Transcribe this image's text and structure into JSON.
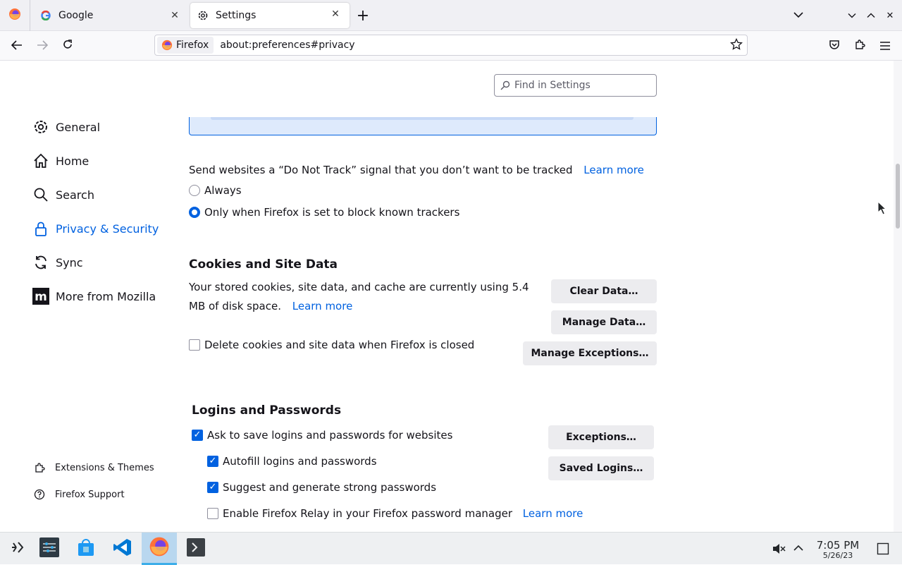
{
  "tabs": [
    {
      "label": "Google",
      "icon": "google-icon"
    },
    {
      "label": "Settings",
      "icon": "gear-icon"
    }
  ],
  "urlbar": {
    "identity_label": "Firefox",
    "url": "about:preferences#privacy"
  },
  "search": {
    "placeholder": "Find in Settings"
  },
  "sidebar": {
    "items": [
      {
        "label": "General",
        "icon": "gear-icon"
      },
      {
        "label": "Home",
        "icon": "home-icon"
      },
      {
        "label": "Search",
        "icon": "search-icon"
      },
      {
        "label": "Privacy & Security",
        "icon": "lock-icon",
        "selected": true
      },
      {
        "label": "Sync",
        "icon": "sync-icon"
      },
      {
        "label": "More from Mozilla",
        "icon": "mozilla-icon"
      }
    ],
    "footer": [
      {
        "label": "Extensions & Themes",
        "icon": "puzzle-icon"
      },
      {
        "label": "Firefox Support",
        "icon": "help-icon"
      }
    ]
  },
  "dnt": {
    "text": "Send websites a “Do Not Track” signal that you don’t want to be tracked",
    "learn_more": "Learn more",
    "options": [
      {
        "label": "Always",
        "selected": false
      },
      {
        "label": "Only when Firefox is set to block known trackers",
        "selected": true
      }
    ]
  },
  "cookies": {
    "heading": "Cookies and Site Data",
    "desc_line1": "Your stored cookies, site data, and cache are currently using 5.4",
    "desc_line2": "MB of disk space.",
    "learn_more": "Learn more",
    "delete_checkbox": {
      "label": "Delete cookies and site data when Firefox is closed",
      "checked": false
    },
    "buttons": {
      "clear": "Clear Data…",
      "manage": "Manage Data…",
      "exceptions": "Manage Exceptions…"
    }
  },
  "logins": {
    "heading": "Logins and Passwords",
    "ask_save": {
      "label": "Ask to save logins and passwords for websites",
      "checked": true
    },
    "autofill": {
      "label": "Autofill logins and passwords",
      "checked": true
    },
    "suggest": {
      "label": "Suggest and generate strong passwords",
      "checked": true
    },
    "relay": {
      "label": "Enable Firefox Relay in your Firefox password manager",
      "checked": false
    },
    "relay_learn_more": "Learn more",
    "buttons": {
      "exceptions": "Exceptions…",
      "saved_logins": "Saved Logins…"
    }
  },
  "taskbar": {
    "time": "7:05 PM",
    "date": "5/26/23"
  },
  "colors": {
    "accent": "#0061e0",
    "taskbar_active": "#b9d7ef"
  }
}
